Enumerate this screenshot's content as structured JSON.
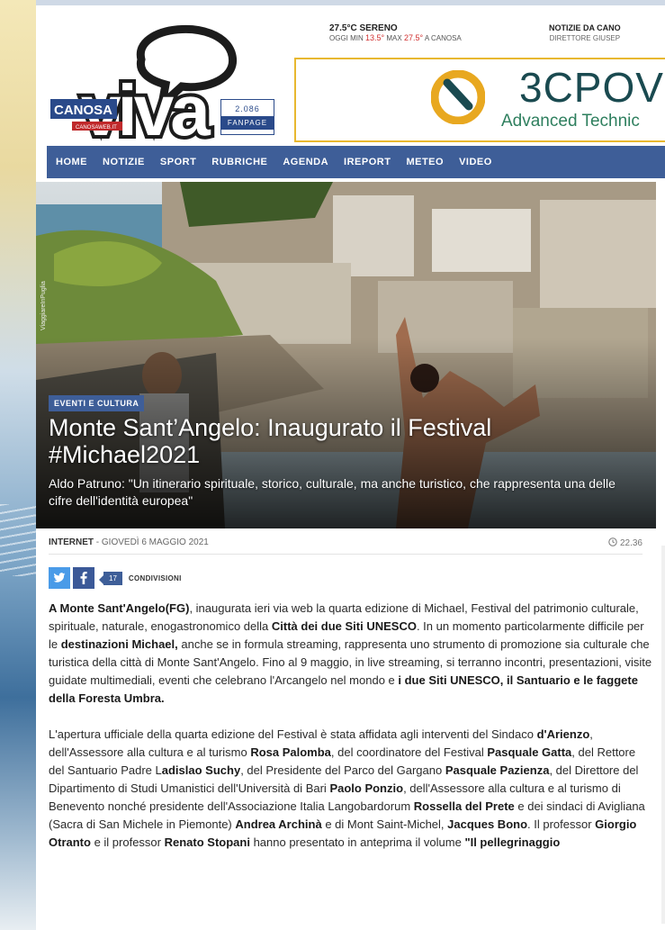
{
  "weather": {
    "temp_line": "27.5°C SERENO",
    "today_label": "OGGI MIN",
    "min": "13.5°",
    "max_label": "MAX",
    "max": "27.5°",
    "location": "A CANOSA"
  },
  "header": {
    "logo_small": "CANOSA",
    "logo_big": "viva",
    "logo_ribbon": "CANOSAWEB.IT",
    "fan_count": "2.086",
    "fan_label": "FANPAGE",
    "news_from_title": "NOTIZIE DA CANO",
    "news_from_sub": "DIRETTORE GIUSEP"
  },
  "banner": {
    "brand": "3CPOV",
    "tagline": "Advanced Technic"
  },
  "nav": {
    "items": [
      "HOME",
      "NOTIZIE",
      "SPORT",
      "RUBRICHE",
      "AGENDA",
      "IREPORT",
      "METEO",
      "VIDEO"
    ]
  },
  "hero": {
    "credit": "ViaggiareInPuglia",
    "category": "EVENTI E CULTURA",
    "title": "Monte Sant’Angelo: Inaugurato il Festival #Michael2021",
    "subtitle": "Aldo Patruno: \"Un itinerario spirituale, storico, culturale, ma anche turistico, che rappresenta una delle cifre dell'identità europea\""
  },
  "meta": {
    "source": "INTERNET",
    "separator": " - ",
    "date": "GIOVEDÌ 6 MAGGIO 2021",
    "time": "22.36"
  },
  "share": {
    "count": "17",
    "label": "CONDIVISIONI"
  },
  "article": {
    "p1": [
      {
        "t": "A Monte Sant'Angelo(FG)",
        "b": true
      },
      {
        "t": ", inaugurata ieri via web la quarta edizione di Michael, Festival del patrimonio culturale, spirituale, naturale, enogastronomico della ",
        "b": false
      },
      {
        "t": "Città dei due Siti UNESCO",
        "b": true
      },
      {
        "t": ". In un momento particolarmente difficile per le ",
        "b": false
      },
      {
        "t": "destinazioni Michael,",
        "b": true
      },
      {
        "t": " anche se in formula streaming, rappresenta uno strumento di promozione sia culturale che turistica della città di Monte Sant'Angelo. Fino al 9 maggio, in live streaming, si terranno incontri, presentazioni, visite guidate multimediali, eventi che celebrano l'Arcangelo nel mondo e ",
        "b": false
      },
      {
        "t": "i due Siti UNESCO, il Santuario e le faggete della Foresta Umbra.",
        "b": true
      }
    ],
    "p2": [
      {
        "t": "L'apertura ufficiale della quarta edizione del Festival è stata affidata agli interventi del Sindaco ",
        "b": false
      },
      {
        "t": "d'Arienzo",
        "b": true
      },
      {
        "t": ", dell'Assessore alla cultura e al turismo ",
        "b": false
      },
      {
        "t": "Rosa Palomba",
        "b": true
      },
      {
        "t": ", del coordinatore del Festival ",
        "b": false
      },
      {
        "t": "Pasquale Gatta",
        "b": true
      },
      {
        "t": ", del Rettore del Santuario Padre L",
        "b": false
      },
      {
        "t": "adislao Suchy",
        "b": true
      },
      {
        "t": ", del Presidente del Parco del Gargano ",
        "b": false
      },
      {
        "t": "Pasquale Pazienza",
        "b": true
      },
      {
        "t": ", del Direttore del Dipartimento di Studi Umanistici dell'Università di Bari ",
        "b": false
      },
      {
        "t": "Paolo Ponzio",
        "b": true
      },
      {
        "t": ", dell'Assessore alla cultura e al turismo di Benevento nonché presidente dell'Associazione Italia Langobardorum ",
        "b": false
      },
      {
        "t": "Rossella del Prete",
        "b": true
      },
      {
        "t": " e dei sindaci di Avigliana (Sacra di San Michele in Piemonte) ",
        "b": false
      },
      {
        "t": "Andrea Archinà",
        "b": true
      },
      {
        "t": " e di Mont Saint-Michel, ",
        "b": false
      },
      {
        "t": "Jacques Bono",
        "b": true
      },
      {
        "t": ". Il professor ",
        "b": false
      },
      {
        "t": "Giorgio Otranto",
        "b": true
      },
      {
        "t": " e il professor ",
        "b": false
      },
      {
        "t": "Renato Stopani",
        "b": true
      },
      {
        "t": " hanno presentato in anteprima il volume ",
        "b": false
      },
      {
        "t": "\"Il pellegrinaggio",
        "b": true
      }
    ]
  },
  "colors": {
    "nav": "#3e5e98",
    "banner_border": "#e8b830",
    "twitter": "#4a9be8",
    "facebook": "#3b5998"
  },
  "icons": [
    "clock-icon",
    "twitter-icon",
    "facebook-icon",
    "speech-bubble-icon",
    "banner-logo-icon"
  ]
}
